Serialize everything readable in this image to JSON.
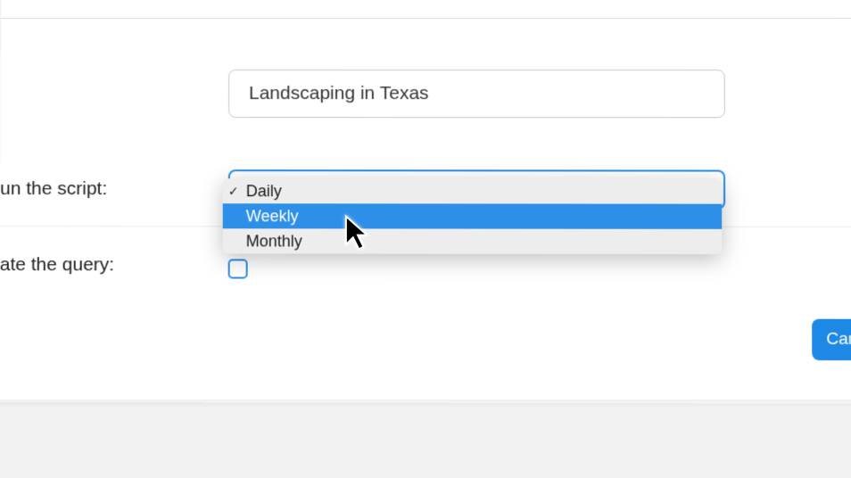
{
  "fields": {
    "searchTerm": {
      "value": "Landscaping in Texas"
    },
    "runScript": {
      "label": "un the script:"
    },
    "updateQuery": {
      "label": "ate the query:"
    }
  },
  "dropdown": {
    "options": [
      {
        "label": "Daily",
        "selected": true,
        "hover": false
      },
      {
        "label": "Weekly",
        "selected": false,
        "hover": true
      },
      {
        "label": "Monthly",
        "selected": false,
        "hover": false
      }
    ]
  },
  "buttons": {
    "cancel": "Can"
  }
}
